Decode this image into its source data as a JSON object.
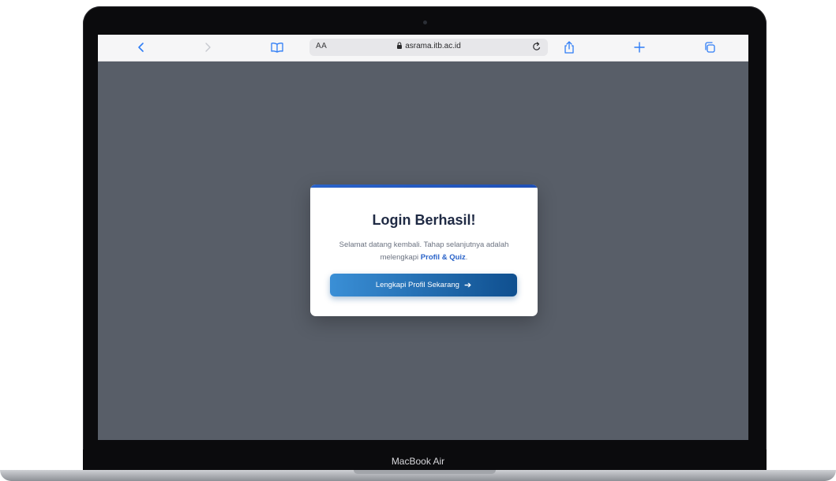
{
  "device": {
    "brand_label": "MacBook Air"
  },
  "browser": {
    "aa_label": "AA",
    "url": "asrama.itb.ac.id",
    "icons": {
      "back": "chevron-left-icon",
      "forward": "chevron-right-icon",
      "bookmarks": "book-icon",
      "lock": "lock-icon",
      "reload": "reload-icon",
      "share": "share-icon",
      "new_tab": "plus-icon",
      "tabs": "tabs-icon"
    },
    "accent_color": "#2f7df6"
  },
  "modal": {
    "title": "Login Berhasil!",
    "message_before": "Selamat datang kembali. Tahap selanjutnya adalah melengkapi ",
    "message_highlight": "Profil & Quiz",
    "message_after": ".",
    "cta_label": "Lengkapi Profil Sekarang",
    "cta_icon": "arrow-right-icon",
    "accent_color": "#2a63c9"
  }
}
